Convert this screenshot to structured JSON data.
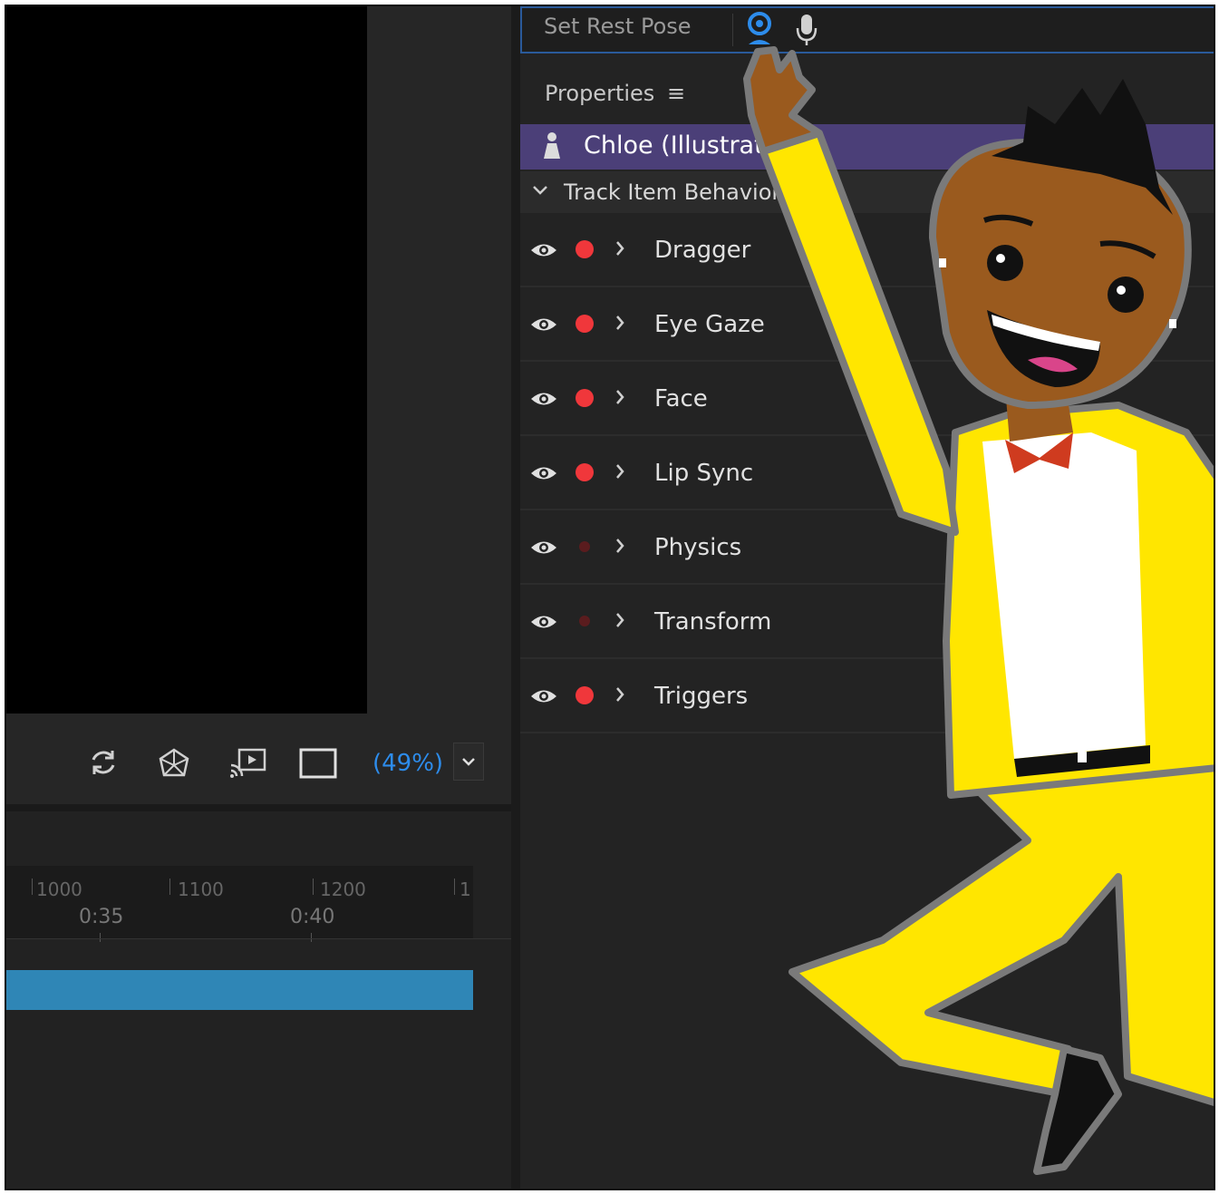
{
  "scene_toolbar": {
    "icons": [
      "refresh-icon",
      "physics-icon",
      "cast-icon",
      "frame-icon"
    ],
    "zoom_label": "(49%)",
    "zoom_dropdown_icon": "chevron-down-icon"
  },
  "timeline": {
    "frame_numbers": [
      "1000",
      "1100",
      "1200",
      "1"
    ],
    "time_labels": [
      "0:35",
      "0:40"
    ],
    "track_color": "#2f86b6"
  },
  "top_bar": {
    "set_rest_pose": "Set Rest Pose",
    "icons": [
      "webcam-icon",
      "microphone-icon"
    ],
    "webcam_color": "#2d8ceb"
  },
  "properties": {
    "title": "Properties",
    "menu_icon": "hamburger-menu-icon",
    "puppet": {
      "name": "Chloe (Illustrato",
      "icon": "puppet-icon",
      "row_color": "#4b3f78"
    },
    "section": {
      "label": "Track Item Behaviors",
      "expanded": true
    },
    "behaviors": [
      {
        "name": "Dragger",
        "armed": true
      },
      {
        "name": "Eye Gaze",
        "armed": true
      },
      {
        "name": "Face",
        "armed": true
      },
      {
        "name": "Lip Sync",
        "armed": true
      },
      {
        "name": "Physics",
        "armed": false
      },
      {
        "name": "Transform",
        "armed": false
      },
      {
        "name": "Triggers",
        "armed": true
      }
    ]
  },
  "colors": {
    "record_armed": "#f0373b",
    "record_disarmed": "#5a1c1e",
    "accent_blue": "#2d8ceb"
  }
}
